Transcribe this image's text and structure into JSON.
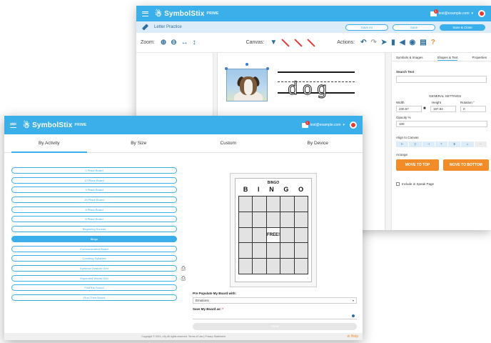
{
  "back_window": {
    "brand": {
      "name": "SymbolStix",
      "tier": "PRIME"
    },
    "user": {
      "email": "test@example.com",
      "notifications": "1"
    },
    "document_title": "Letter Practice",
    "buttons": {
      "save_as": "Save As",
      "save": "Save",
      "save_close": "Save & Close"
    },
    "toolbar": {
      "zoom_label": "Zoom:",
      "canvas_label": "Canvas:",
      "actions_label": "Actions:"
    },
    "canvas": {
      "trace_word": "dog"
    },
    "right_panel": {
      "tabs": [
        "Symbols & Images",
        "Shapes & Text",
        "Properties"
      ],
      "search_label": "Search Text",
      "general_settings": "GENERAL SETTINGS",
      "width_label": "Width",
      "width_value": "230.57",
      "height_label": "Height",
      "height_value": "197.84",
      "rotation_label": "Rotation °",
      "rotation_value": "0",
      "opacity_label": "Opacity %",
      "opacity_value": "100",
      "align_label": "Align to Canvas",
      "arrange_label": "Arrange",
      "move_top": "MOVE TO TOP",
      "move_bottom": "MOVE TO BOTTOM",
      "include_speak": "Include in Speak Page"
    }
  },
  "front_window": {
    "brand": {
      "name": "SymbolStix",
      "tier": "PRIME"
    },
    "user": {
      "email": "test@example.com",
      "notifications": "1"
    },
    "tabs": [
      "By Activity",
      "By Size",
      "Custom",
      "By Device"
    ],
    "active_tab": "By Activity",
    "activities": [
      {
        "label": "2 Place Board",
        "selected": false,
        "printable": false
      },
      {
        "label": "12 Place Board",
        "selected": false,
        "printable": false
      },
      {
        "label": "3 Place Board",
        "selected": false,
        "printable": false
      },
      {
        "label": "20 Place Board",
        "selected": false,
        "printable": false
      },
      {
        "label": "4 Place Board",
        "selected": false,
        "printable": false
      },
      {
        "label": "6 Place Board",
        "selected": false,
        "printable": false
      },
      {
        "label": "Beginning Sounds",
        "selected": false,
        "printable": false
      },
      {
        "label": "Bingo",
        "selected": true,
        "printable": false
      },
      {
        "label": "Communication Board",
        "selected": false,
        "printable": false
      },
      {
        "label": "Counting Syllables",
        "selected": false,
        "printable": false
      },
      {
        "label": "Eyebrow Gesture Grid",
        "selected": false,
        "printable": true
      },
      {
        "label": "Expanded Words Grid",
        "selected": false,
        "printable": true
      },
      {
        "label": "Find the Sound",
        "selected": false,
        "printable": false
      },
      {
        "label": "First-Then Board",
        "selected": false,
        "printable": false
      }
    ],
    "preview": {
      "title": "BINGO",
      "letters": [
        "B",
        "I",
        "N",
        "G",
        "O"
      ],
      "free_label": "FREE!"
    },
    "form": {
      "prepopulate_label": "Pre Populate My Board with:",
      "prepopulate_value": "Emotions",
      "save_label": "Save My Board as:",
      "required_mark": "*",
      "submit_label": "Save"
    },
    "footer": {
      "copyright": "Copyright © 2021, n2y All rights reserved. Terms of Use | Privacy Statement",
      "help": "Help"
    }
  },
  "colors": {
    "primary": "#3aafe9",
    "accent": "#f28c28",
    "alert": "#e53935"
  }
}
